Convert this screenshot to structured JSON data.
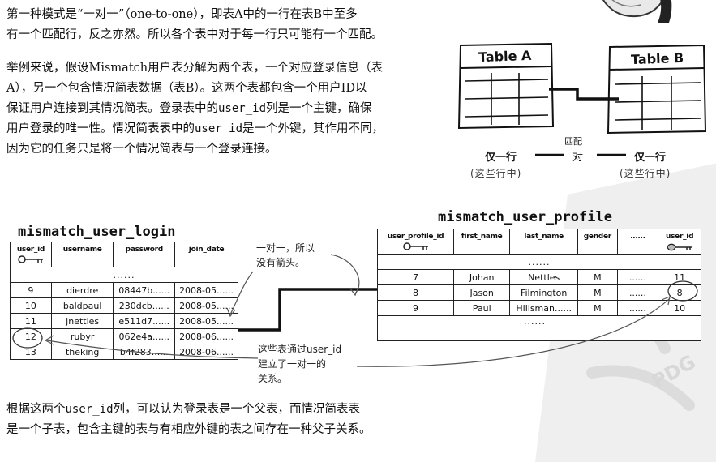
{
  "intro": {
    "lines": [
      "第一种模式是“一对一”（one-to-one），即表A中的一行在表B中至多",
      "有一个匹配行，反之亦然。所以各个表中对于每一行只可能有一个匹配。"
    ]
  },
  "example": {
    "lines": [
      [
        "举例来说，假设Mismatch用户表分解为两个表，一个对应登录信息（表"
      ],
      [
        "A），另一个包含情况简表数据（表B）。这两个表都包含一个用户ID以"
      ],
      [
        "保证用户连接到其情况简表。登录表中的",
        "user_id",
        "列是一个主键，确保"
      ],
      [
        "用户登录的唯一性。情况简表表中的",
        "user_id",
        "是一个外键，其作用不同，"
      ],
      [
        "因为它的任务只是将一个情况简表与一个登录连接。"
      ]
    ]
  },
  "conclusion": {
    "lines": [
      [
        "根据这两个",
        "user_id",
        "列，可以认为登录表是一个父表，而情况简表表"
      ],
      [
        "是一个子表，包含主键的表与有相应外键的表之间存在一种父子关系。"
      ]
    ]
  },
  "diagram": {
    "table_a": "Table A",
    "table_b": "Table B",
    "match_label": "匹配",
    "left_caption": "仅一行",
    "middle_caption": "对",
    "right_caption": "仅一行",
    "left_sub": "(这些行中)",
    "right_sub": "(这些行中)"
  },
  "login_table": {
    "name": "mismatch_user_login",
    "headers": [
      "user_id",
      "username",
      "password",
      "join_date"
    ],
    "gap": "......",
    "rows": [
      [
        "9",
        "dierdre",
        "08447b......",
        "2008-05......"
      ],
      [
        "10",
        "baldpaul",
        "230dcb......",
        "2008-05......"
      ],
      [
        "11",
        "jnettles",
        "e511d7......",
        "2008-05......"
      ],
      [
        "12",
        "rubyr",
        "062e4a......",
        "2008-06......"
      ],
      [
        "13",
        "theking",
        "b4f283......",
        "2008-06......"
      ]
    ]
  },
  "profile_table": {
    "name": "mismatch_user_profile",
    "headers": [
      "user_profile_id",
      "first_name",
      "last_name",
      "gender",
      "......",
      "user_id"
    ],
    "gap": "......",
    "rows": [
      [
        "7",
        "Johan",
        "Nettles",
        "M",
        "......",
        "11"
      ],
      [
        "8",
        "Jason",
        "Filmington",
        "M",
        "......",
        "8"
      ],
      [
        "9",
        "Paul",
        "Hillsman......",
        "M",
        "......",
        "10"
      ]
    ],
    "tail": "......"
  },
  "notes": {
    "one_to_one": [
      "一对一，所以",
      "没有箭头。"
    ],
    "connect": [
      "这些表通过user_id",
      "建立了一对一的",
      "关系。"
    ]
  },
  "watermark_text": "PDG"
}
